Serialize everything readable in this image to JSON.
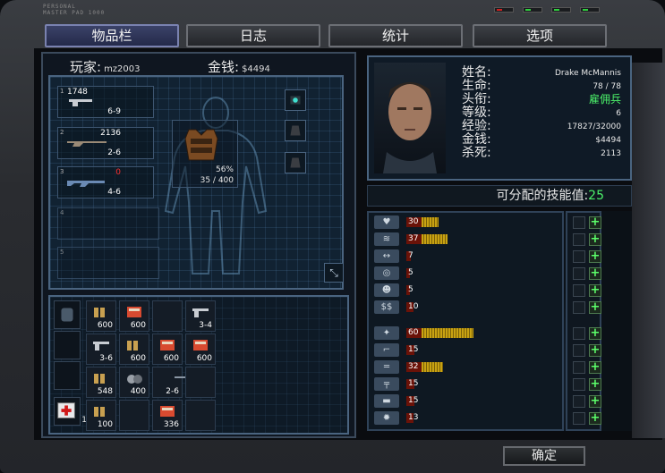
{
  "brand": {
    "line1": "PERSONAL",
    "line2": "MASTER PAD 1000"
  },
  "tabs": [
    {
      "label": "物品栏",
      "active": true
    },
    {
      "label": "日志",
      "active": false
    },
    {
      "label": "统计",
      "active": false
    },
    {
      "label": "选项",
      "active": false
    }
  ],
  "player": {
    "label": "玩家:",
    "name": "mz2003",
    "money_label": "金钱:",
    "money": "$4494"
  },
  "weapons": [
    {
      "slot": "1",
      "ammo": "1748",
      "damage": "6-9"
    },
    {
      "slot": "2",
      "ammo": "2136",
      "damage": "2-6"
    },
    {
      "slot": "3",
      "ammo": "0",
      "damage": "4-6",
      "ammo_color": "#ff3030"
    },
    {
      "slot": "4",
      "ammo": "",
      "damage": ""
    },
    {
      "slot": "5",
      "ammo": "",
      "damage": ""
    }
  ],
  "armor": {
    "percent": "56%",
    "durability": "35 / 400"
  },
  "inventory": [
    {
      "row": 0,
      "col": 0,
      "count": "600",
      "icon": "ammo-icon"
    },
    {
      "row": 0,
      "col": 1,
      "count": "600",
      "icon": "ammo-box-icon"
    },
    {
      "row": 0,
      "col": 2,
      "count": "",
      "icon": ""
    },
    {
      "row": 0,
      "col": 3,
      "count": "3-4",
      "icon": "pistol-icon"
    },
    {
      "row": 1,
      "col": 0,
      "count": "3-6",
      "icon": "pistol-icon"
    },
    {
      "row": 1,
      "col": 1,
      "count": "600",
      "icon": "ammo-icon"
    },
    {
      "row": 1,
      "col": 2,
      "count": "600",
      "icon": "ammo-box-icon"
    },
    {
      "row": 1,
      "col": 3,
      "count": "600",
      "icon": "ammo-box-icon"
    },
    {
      "row": 2,
      "col": 0,
      "count": "548",
      "icon": "ammo-icon"
    },
    {
      "row": 2,
      "col": 1,
      "count": "400",
      "icon": "grenade-icon"
    },
    {
      "row": 2,
      "col": 2,
      "count": "2-6",
      "icon": "rifle-icon"
    },
    {
      "row": 2,
      "col": 3,
      "count": "",
      "icon": ""
    },
    {
      "row": 3,
      "col": 0,
      "count": "100",
      "icon": "ammo-icon"
    },
    {
      "row": 3,
      "col": 1,
      "count": "",
      "icon": ""
    },
    {
      "row": 3,
      "col": 2,
      "count": "336",
      "icon": "ammo-box-icon"
    },
    {
      "row": 3,
      "col": 3,
      "count": "",
      "icon": ""
    }
  ],
  "medkit": {
    "count": "1"
  },
  "character": {
    "name_label": "姓名:",
    "name": "Drake McMannis",
    "life_label": "生命:",
    "life": "78 / 78",
    "title_label": "头衔:",
    "title": "雇佣兵",
    "level_label": "等级:",
    "level": "6",
    "exp_label": "经验:",
    "exp": "17827/32000",
    "money_label": "金钱:",
    "money": "$4494",
    "kills_label": "杀死:",
    "kills": "2113"
  },
  "skill_points": {
    "label": "可分配的技能值:",
    "value": "25"
  },
  "skills": [
    {
      "icon": "health-icon",
      "value": "30",
      "red_frac": 0.35,
      "yel_frac": 0.2
    },
    {
      "icon": "endurance-icon",
      "value": "37",
      "red_frac": 0.35,
      "yel_frac": 0.3
    },
    {
      "icon": "speed-icon",
      "value": "7",
      "red_frac": 0.1,
      "yel_frac": 0.0
    },
    {
      "icon": "accuracy-icon",
      "value": "5",
      "red_frac": 0.08,
      "yel_frac": 0.0
    },
    {
      "icon": "stealth-icon",
      "value": "5",
      "red_frac": 0.08,
      "yel_frac": 0.0
    },
    {
      "icon": "trade-icon",
      "value": "10",
      "red_frac": 0.16,
      "yel_frac": 0.0
    },
    {
      "icon": "melee-icon",
      "value": "60",
      "red_frac": 0.35,
      "yel_frac": 0.6
    },
    {
      "icon": "pistol-skill-icon",
      "value": "15",
      "red_frac": 0.18,
      "yel_frac": 0.0
    },
    {
      "icon": "rifle-skill-icon",
      "value": "32",
      "red_frac": 0.35,
      "yel_frac": 0.25
    },
    {
      "icon": "shotgun-skill-icon",
      "value": "15",
      "red_frac": 0.18,
      "yel_frac": 0.0
    },
    {
      "icon": "heavy-skill-icon",
      "value": "15",
      "red_frac": 0.18,
      "yel_frac": 0.0
    },
    {
      "icon": "explosive-skill-icon",
      "value": "13",
      "red_frac": 0.16,
      "yel_frac": 0.0
    }
  ],
  "buttons": {
    "ok": "确定",
    "plus": "+"
  },
  "colors": {
    "green": "#4cf26a",
    "red_bar": "#6a1208",
    "yellow_bar": "#c8a212",
    "tab_active": "#3b4268"
  }
}
